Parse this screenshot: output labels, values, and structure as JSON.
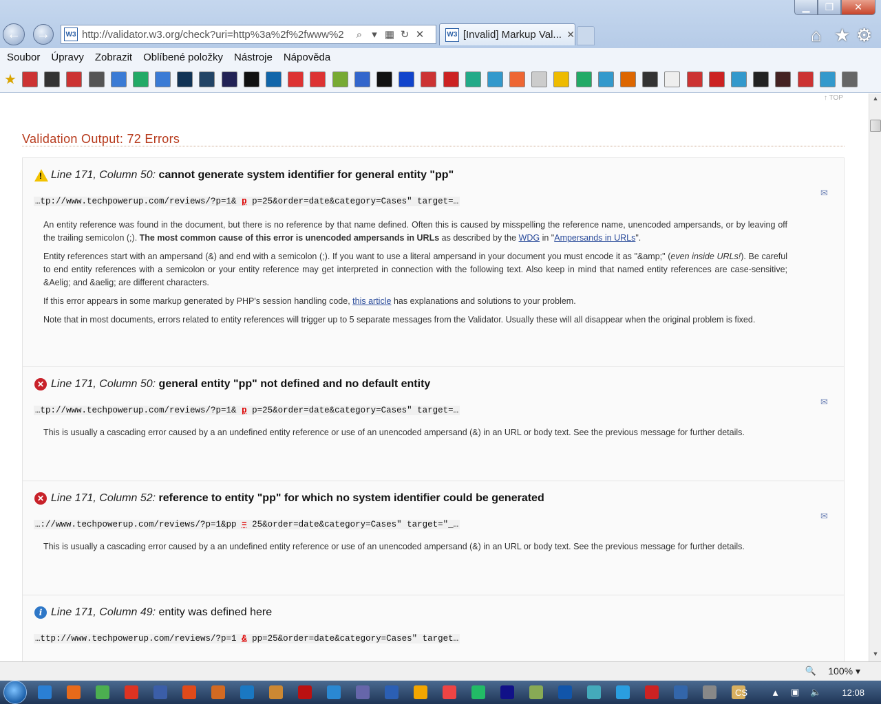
{
  "browser": {
    "url": "http://validator.w3.org/check?uri=http%3a%2f%2fwww%2",
    "tab_title": "[Invalid] Markup Val...",
    "favicon_label": "W3",
    "menu": [
      "Soubor",
      "Úpravy",
      "Zobrazit",
      "Oblíbené položky",
      "Nástroje",
      "Nápověda"
    ],
    "favorites_count": 39,
    "zoom": "100%"
  },
  "page": {
    "top_link": "↑ TOP",
    "heading": "Validation Output: 72 Errors",
    "messages": [
      {
        "type": "warning",
        "location": "Line 171, Column 50",
        "text": "cannot generate system identifier for general entity \"pp\"",
        "code_before": "…tp://www.techpowerup.com/reviews/?p=1&",
        "code_hl": "p",
        "code_after": "p=25&order=date&category=Cases\" target=…",
        "explain_1a": "An entity reference was found in the document, but there is no reference by that name defined. Often this is caused by misspelling the reference name, unencoded ampersands, or by leaving off the trailing semicolon (;).",
        "explain_1b": "The most common cause of this error is unencoded ampersands in URLs",
        "explain_1c": "as described by the",
        "explain_1_link1": "WDG",
        "explain_1d": "in \"",
        "explain_1_link2": "Ampersands in URLs",
        "explain_1e": "\".",
        "explain_2a": "Entity references start with an ampersand (&) and end with a semicolon (;). If you want to use a literal ampersand in your document you must encode it as \"&amp;\" (",
        "explain_2b": "even inside URLs!",
        "explain_2c": "). Be careful to end entity references with a semicolon or your entity reference may get interpreted in connection with the following text. Also keep in mind that named entity references are case-sensitive; &Aelig; and &aelig; are different characters.",
        "explain_3a": "If this error appears in some markup generated by PHP's session handling code,",
        "explain_3_link": "this article",
        "explain_3b": "has explanations and solutions to your problem.",
        "explain_4": "Note that in most documents, errors related to entity references will trigger up to 5 separate messages from the Validator. Usually these will all disappear when the original problem is fixed."
      },
      {
        "type": "error",
        "location": "Line 171, Column 50",
        "text": "general entity \"pp\" not defined and no default entity",
        "code_before": "…tp://www.techpowerup.com/reviews/?p=1&",
        "code_hl": "p",
        "code_after": "p=25&order=date&category=Cases\" target=…",
        "explain": "This is usually a cascading error caused by a an undefined entity reference or use of an unencoded ampersand (&) in an URL or body text. See the previous message for further details."
      },
      {
        "type": "error",
        "location": "Line 171, Column 52",
        "text": "reference to entity \"pp\" for which no system identifier could be generated",
        "code_before": "…://www.techpowerup.com/reviews/?p=1&pp",
        "code_hl": "=",
        "code_after": "25&order=date&category=Cases\" target=\"_…",
        "explain": "This is usually a cascading error caused by a an undefined entity reference or use of an unencoded ampersand (&) in an URL or body text. See the previous message for further details."
      },
      {
        "type": "info",
        "location": "Line 171, Column 49",
        "text": "entity was defined here",
        "code_before": "…ttp://www.techpowerup.com/reviews/?p=1",
        "code_hl": "&",
        "code_after": "pp=25&order=date&category=Cases\" target…"
      }
    ]
  },
  "taskbar": {
    "language": "CS",
    "clock": "12:08"
  },
  "colors": {
    "heading": "#b73a1c",
    "error_icon": "#c8222a",
    "info_icon": "#2e77c7",
    "warning_icon": "#f2c200",
    "link": "#2a4b9a"
  }
}
